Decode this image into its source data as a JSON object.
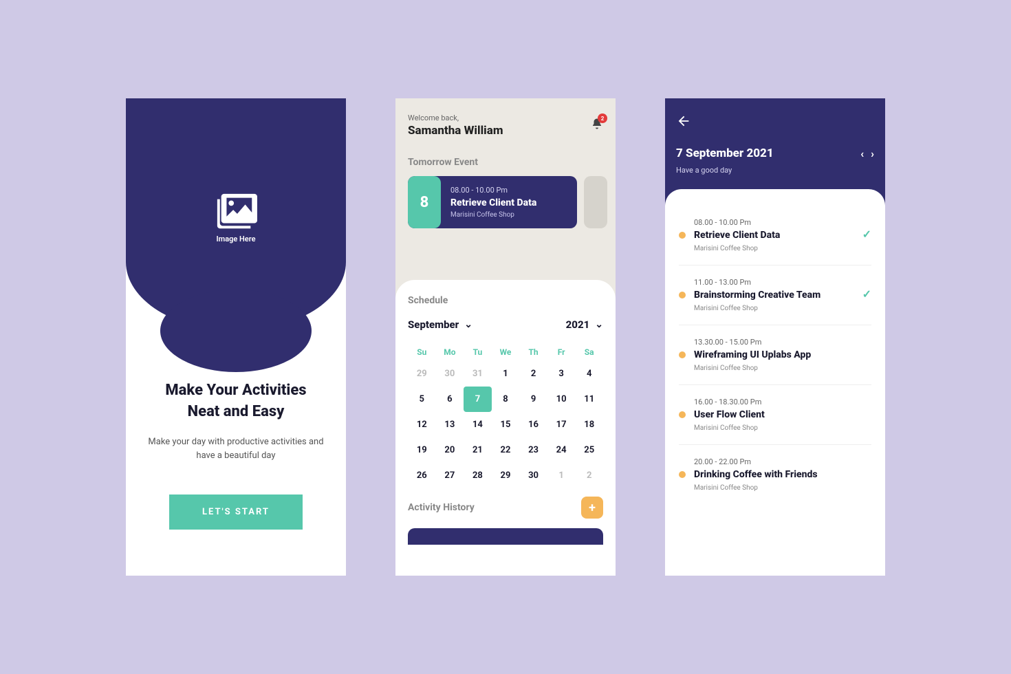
{
  "colors": {
    "primary": "#312e6e",
    "accent": "#56c7ab",
    "warn": "#f5b659",
    "badge": "#e33b3b"
  },
  "onboarding": {
    "img_label": "Image Here",
    "title_line1": "Make Your Activities",
    "title_line2": "Neat and Easy",
    "subtitle": "Make your day with productive activities and have a beautiful day",
    "cta": "LET'S START"
  },
  "home": {
    "welcome": "Welcome back,",
    "username": "Samantha William",
    "badge_count": "2",
    "tomorrow_label": "Tomorrow Event",
    "event": {
      "day": "8",
      "time": "08.00 - 10.00 Pm",
      "title": "Retrieve Client Data",
      "location": "Marisini Coffee Shop"
    },
    "schedule_label": "Schedule",
    "month": "September",
    "year": "2021",
    "dow": [
      "Su",
      "Mo",
      "Tu",
      "We",
      "Th",
      "Fr",
      "Sa"
    ],
    "days": [
      {
        "n": "29",
        "muted": true
      },
      {
        "n": "30",
        "muted": true
      },
      {
        "n": "31",
        "muted": true
      },
      {
        "n": "1"
      },
      {
        "n": "2"
      },
      {
        "n": "3"
      },
      {
        "n": "4"
      },
      {
        "n": "5"
      },
      {
        "n": "6"
      },
      {
        "n": "7",
        "sel": true
      },
      {
        "n": "8"
      },
      {
        "n": "9"
      },
      {
        "n": "10"
      },
      {
        "n": "11"
      },
      {
        "n": "12"
      },
      {
        "n": "13"
      },
      {
        "n": "14"
      },
      {
        "n": "15"
      },
      {
        "n": "16"
      },
      {
        "n": "17"
      },
      {
        "n": "18"
      },
      {
        "n": "19"
      },
      {
        "n": "20"
      },
      {
        "n": "21"
      },
      {
        "n": "22"
      },
      {
        "n": "23"
      },
      {
        "n": "24"
      },
      {
        "n": "25"
      },
      {
        "n": "26"
      },
      {
        "n": "27"
      },
      {
        "n": "28"
      },
      {
        "n": "29"
      },
      {
        "n": "30"
      },
      {
        "n": "1",
        "muted": true
      },
      {
        "n": "2",
        "muted": true
      }
    ],
    "history_label": "Activity History"
  },
  "day": {
    "date": "7 September 2021",
    "greeting": "Have a good day",
    "agenda": [
      {
        "time": "08.00 - 10.00 Pm",
        "title": "Retrieve Client Data",
        "location": "Marisini Coffee Shop",
        "done": true
      },
      {
        "time": "11.00 - 13.00 Pm",
        "title": "Brainstorming Creative Team",
        "location": "Marisini Coffee Shop",
        "done": true
      },
      {
        "time": "13.30.00 - 15.00 Pm",
        "title": "Wireframing UI Uplabs App",
        "location": "Marisini Coffee Shop",
        "done": false
      },
      {
        "time": "16.00 - 18.30.00 Pm",
        "title": "User Flow Client",
        "location": "Marisini Coffee Shop",
        "done": false
      },
      {
        "time": "20.00 - 22.00 Pm",
        "title": "Drinking Coffee with Friends",
        "location": "Marisini Coffee Shop",
        "done": false
      }
    ]
  }
}
